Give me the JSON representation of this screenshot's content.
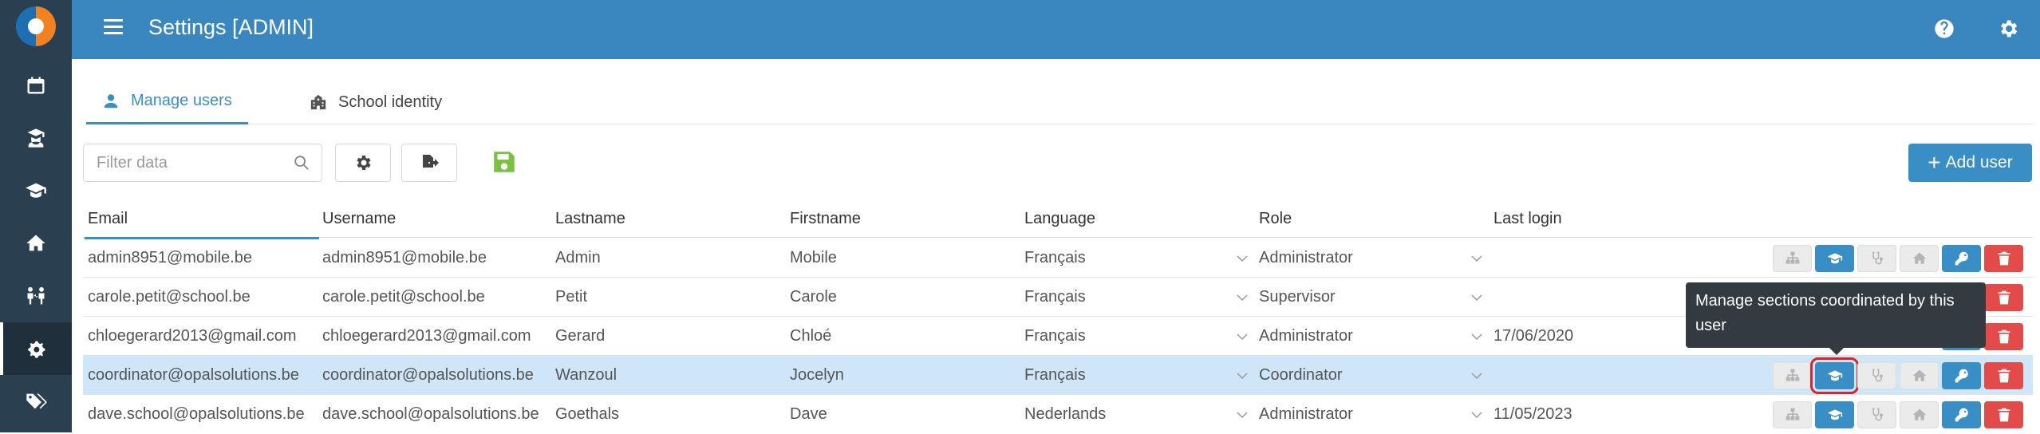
{
  "app": {
    "title": "Settings [ADMIN]"
  },
  "sidebar": {
    "items": [
      {
        "icon": "calendar-icon"
      },
      {
        "icon": "teacher-icon"
      },
      {
        "icon": "graduation-cap-icon"
      },
      {
        "icon": "home-icon"
      },
      {
        "icon": "people-arrows-icon"
      },
      {
        "icon": "gears-icon",
        "active": true
      },
      {
        "icon": "tags-icon"
      }
    ]
  },
  "topbar": {
    "help_icon": "question-circle-icon",
    "settings_icon": "gear-icon"
  },
  "tabs": [
    {
      "label": "Manage users",
      "icon": "user-icon",
      "active": true
    },
    {
      "label": "School identity",
      "icon": "school-icon",
      "active": false
    }
  ],
  "toolbar": {
    "filter_placeholder": "Filter data",
    "add_user_label": "Add user"
  },
  "table": {
    "columns": [
      "Email",
      "Username",
      "Lastname",
      "Firstname",
      "Language",
      "Role",
      "Last login"
    ],
    "rows": [
      {
        "email": "admin8951@mobile.be",
        "username": "admin8951@mobile.be",
        "lastname": "Admin",
        "firstname": "Mobile",
        "language": "Français",
        "role": "Administrator",
        "last_login": ""
      },
      {
        "email": "carole.petit@school.be",
        "username": "carole.petit@school.be",
        "lastname": "Petit",
        "firstname": "Carole",
        "language": "Français",
        "role": "Supervisor",
        "last_login": ""
      },
      {
        "email": "chloegerard2013@gmail.com",
        "username": "chloegerard2013@gmail.com",
        "lastname": "Gerard",
        "firstname": "Chloé",
        "language": "Français",
        "role": "Administrator",
        "last_login": "17/06/2020"
      },
      {
        "email": "coordinator@opalsolutions.be",
        "username": "coordinator@opalsolutions.be",
        "lastname": "Wanzoul",
        "firstname": "Jocelyn",
        "language": "Français",
        "role": "Coordinator",
        "last_login": "",
        "selected": true
      },
      {
        "email": "dave.school@opalsolutions.be",
        "username": "dave.school@opalsolutions.be",
        "lastname": "Goethals",
        "firstname": "Dave",
        "language": "Nederlands",
        "role": "Administrator",
        "last_login": "11/05/2023"
      }
    ]
  },
  "tooltip": {
    "text": "Manage sections coordinated by this user"
  },
  "colors": {
    "topbar": "#3987be",
    "sidebar": "#2a3f4f",
    "accent": "#3a8ec6",
    "danger": "#e34a4a",
    "selected_row": "#cfe6f8",
    "save_icon": "#7ac142"
  }
}
